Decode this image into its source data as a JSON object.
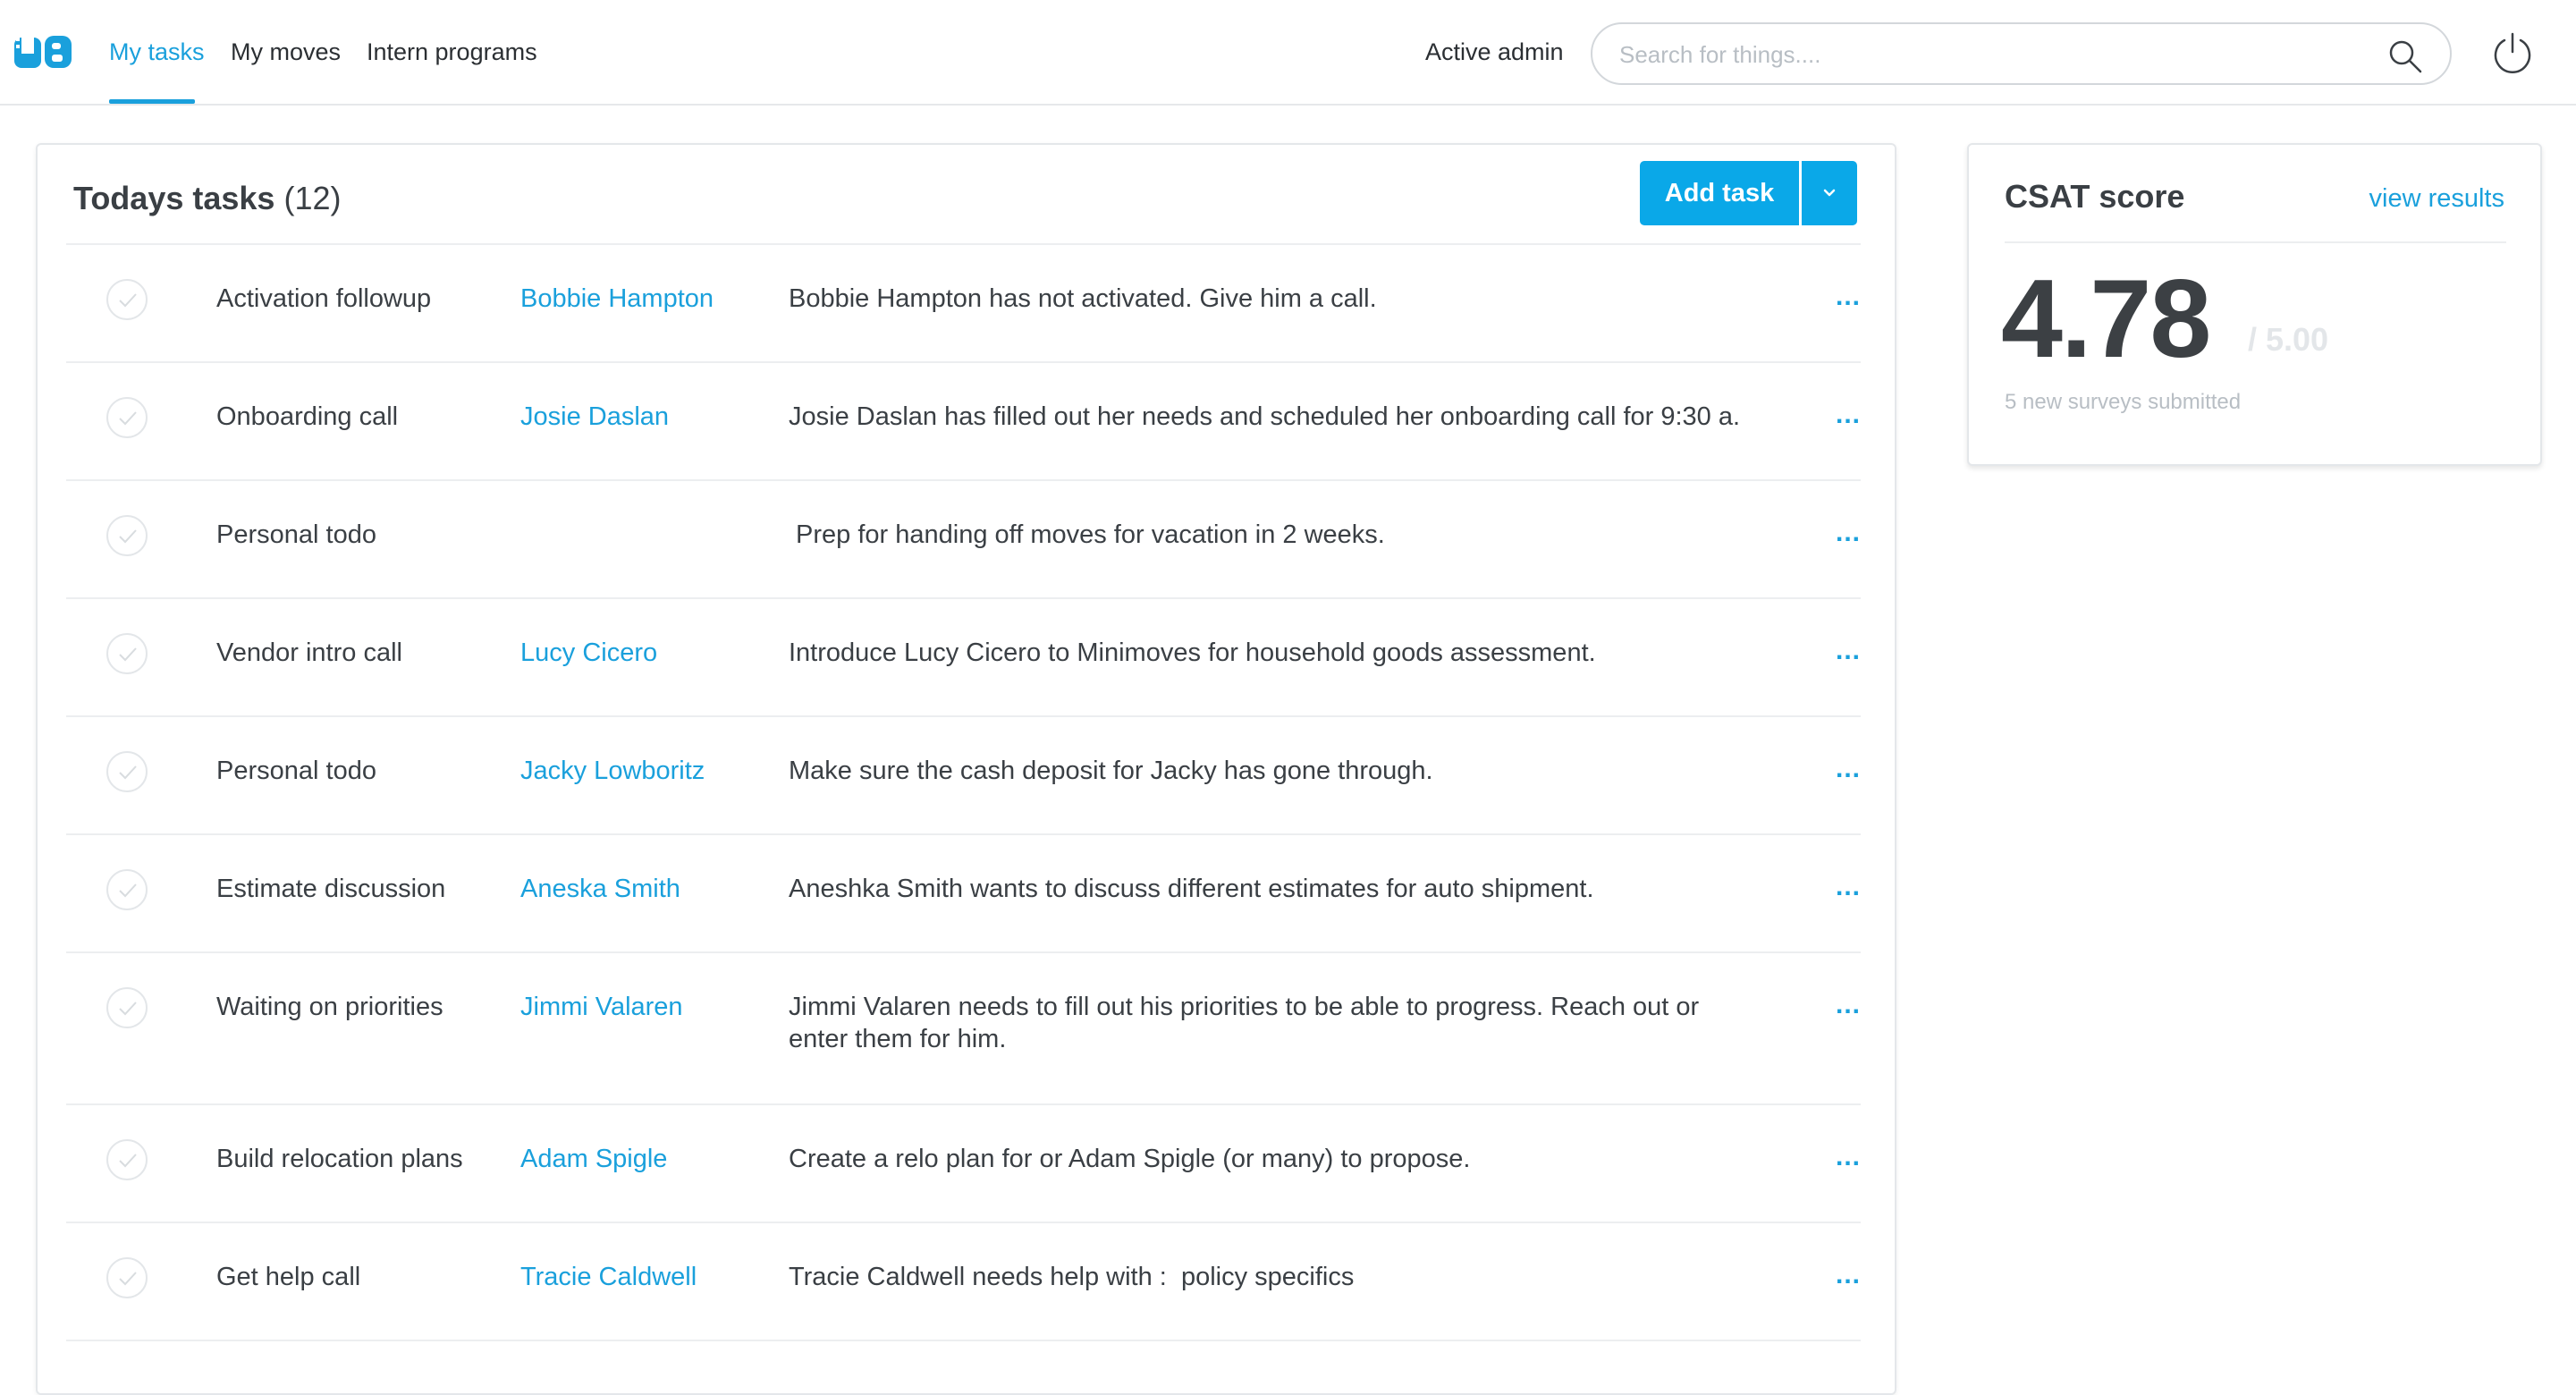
{
  "nav": {
    "logo_text": "UB",
    "items": [
      {
        "label": "My tasks",
        "active": true
      },
      {
        "label": "My moves",
        "active": false
      },
      {
        "label": "Intern programs",
        "active": false
      }
    ],
    "admin_label": "Active admin",
    "search": {
      "placeholder": "Search for things....",
      "value": ""
    }
  },
  "tasks": {
    "title": "Todays tasks",
    "count": "(12)",
    "add_label": "Add task",
    "rows": [
      {
        "type": "Activation followup",
        "contact": "Bobbie Hampton",
        "description": "Bobbie Hampton has not activated. Give him a call.",
        "more": "..."
      },
      {
        "type": "Onboarding call",
        "contact": "Josie Daslan",
        "description": "Josie Daslan has filled out her needs and scheduled her onboarding call for 9:30 a.",
        "more": "..."
      },
      {
        "type": "Personal todo",
        "contact": "",
        "description": " Prep for handing off moves for vacation in 2 weeks.",
        "more": "..."
      },
      {
        "type": "Vendor intro call",
        "contact": "Lucy Cicero",
        "description": "Introduce Lucy Cicero to Minimoves for household goods assessment.",
        "more": "..."
      },
      {
        "type": "Personal todo",
        "contact": "Jacky Lowboritz",
        "description": "Make sure the cash deposit for Jacky has gone through.",
        "more": "..."
      },
      {
        "type": "Estimate discussion",
        "contact": "Aneska Smith",
        "description": "Aneshka Smith wants to discuss different estimates for auto shipment.",
        "more": "..."
      },
      {
        "type": "Waiting on priorities",
        "contact": "Jimmi Valaren",
        "description": "Jimmi Valaren needs to fill out his priorities to be able to progress. Reach out or enter them for him.",
        "more": "..."
      },
      {
        "type": "Build relocation plans",
        "contact": "Adam Spigle",
        "description": "Create a relo plan for or Adam Spigle (or many) to propose.",
        "more": "..."
      },
      {
        "type": "Get help call",
        "contact": "Tracie Caldwell",
        "description": "Tracie Caldwell needs help with :  policy specifics",
        "more": "..."
      }
    ]
  },
  "csat": {
    "title": "CSAT score",
    "link": "view results",
    "score": "4.78",
    "max": "/ 5.00",
    "subtitle": "5 new surveys submitted"
  },
  "colors": {
    "accent": "#1aa0dc",
    "button": "#0aa8e8",
    "text": "#3a3f44",
    "muted": "#b8bec4"
  },
  "icons": [
    "ub-logo-icon",
    "search-icon",
    "power-icon",
    "chevron-down-icon",
    "checkmark-icon"
  ]
}
